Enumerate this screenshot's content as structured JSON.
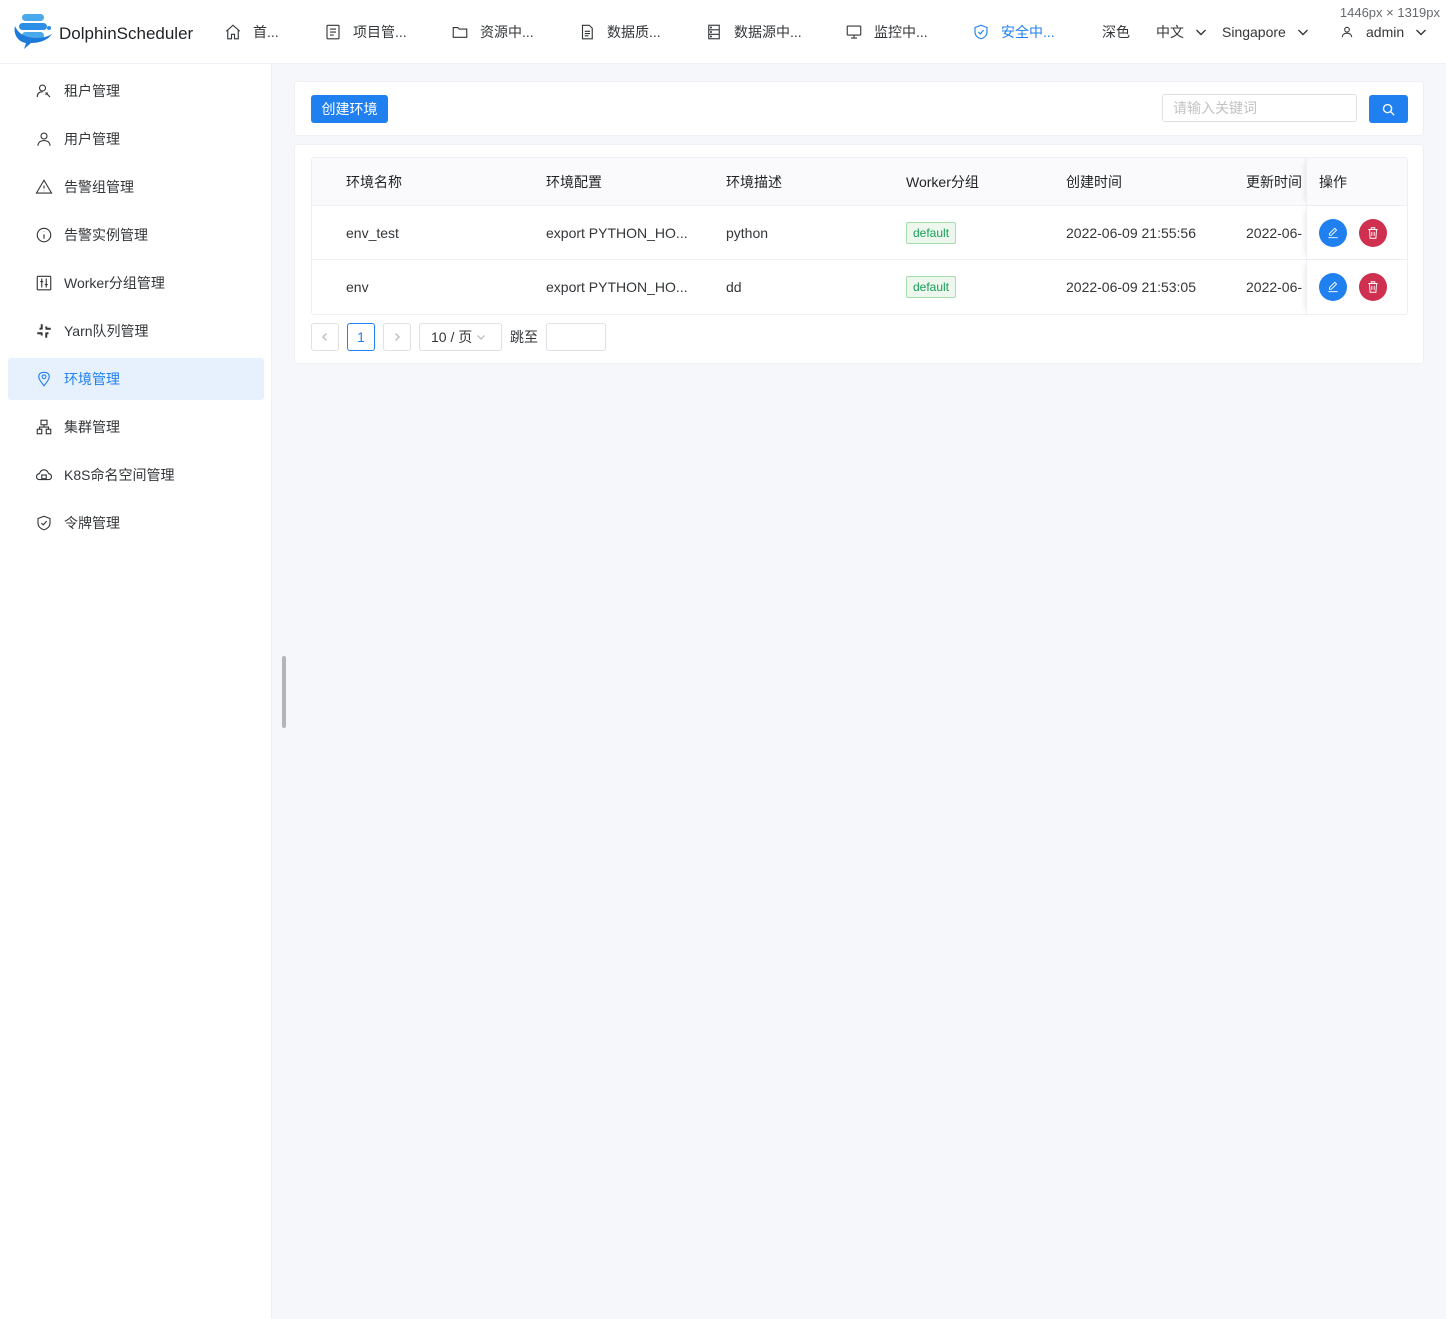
{
  "window": {
    "dimension_label": "1446px × 1319px"
  },
  "header": {
    "logo_text": "DolphinScheduler",
    "nav": [
      {
        "label": "首...",
        "icon": "home-icon"
      },
      {
        "label": "项目管...",
        "icon": "project-icon"
      },
      {
        "label": "资源中...",
        "icon": "folder-icon"
      },
      {
        "label": "数据质...",
        "icon": "data-quality-icon"
      },
      {
        "label": "数据源中...",
        "icon": "datasource-icon"
      },
      {
        "label": "监控中...",
        "icon": "monitor-icon"
      },
      {
        "label": "安全中...",
        "icon": "shield-check-icon",
        "active": true
      }
    ],
    "theme_label": "深色",
    "language_label": "中文",
    "timezone_label": "Singapore",
    "user_label": "admin"
  },
  "sidebar": {
    "items": [
      {
        "label": "租户管理",
        "icon": "tenant-icon"
      },
      {
        "label": "用户管理",
        "icon": "user-icon"
      },
      {
        "label": "告警组管理",
        "icon": "warning-icon"
      },
      {
        "label": "告警实例管理",
        "icon": "info-icon"
      },
      {
        "label": "Worker分组管理",
        "icon": "sliders-icon"
      },
      {
        "label": "Yarn队列管理",
        "icon": "slack-icon"
      },
      {
        "label": "环境管理",
        "icon": "location-icon",
        "active": true
      },
      {
        "label": "集群管理",
        "icon": "cluster-icon"
      },
      {
        "label": "K8S命名空间管理",
        "icon": "cloud-icon"
      },
      {
        "label": "令牌管理",
        "icon": "token-shield-icon"
      }
    ]
  },
  "toolbar": {
    "create_label": "创建环境",
    "search_placeholder": "请输入关键词",
    "search_icon": "search-icon"
  },
  "table": {
    "columns": [
      "环境名称",
      "环境配置",
      "环境描述",
      "Worker分组",
      "创建时间",
      "更新时间",
      "操作"
    ],
    "rows": [
      {
        "name": "env_test",
        "config": "export PYTHON_HO...",
        "desc": "python",
        "worker": "default",
        "created": "2022-06-09 21:55:56",
        "updated": "2022-06-"
      },
      {
        "name": "env",
        "config": "export PYTHON_HO...",
        "desc": "dd",
        "worker": "default",
        "created": "2022-06-09 21:53:05",
        "updated": "2022-06-"
      }
    ]
  },
  "pagination": {
    "current_page": "1",
    "page_size_label": "10 / 页",
    "jump_label": "跳至",
    "jump_value": ""
  },
  "colors": {
    "primary": "#2080f0",
    "danger": "#d03050",
    "success": "#18a058"
  }
}
